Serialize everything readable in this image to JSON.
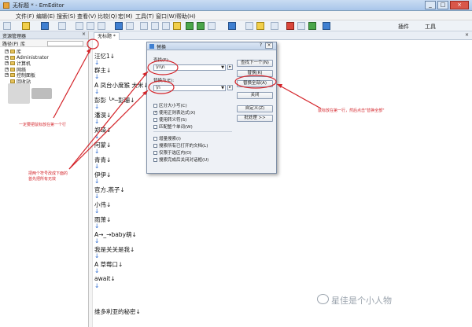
{
  "window": {
    "title": "无标题 * - EmEditor",
    "controls": [
      "_",
      "□",
      "×"
    ]
  },
  "menu": [
    "文件(F)",
    "编辑(E)",
    "搜索(S)",
    "查看(V)",
    "比较(Q)",
    "宏(M)",
    "工具(T)",
    "窗口(W)",
    "帮助(H)"
  ],
  "toolbar_right": [
    "插件",
    "工具"
  ],
  "sidebar": {
    "header": "资源管理器",
    "close": "×",
    "path_label": "路径(P)",
    "library": "库",
    "tree": [
      "库",
      "Administrator",
      "计算机",
      "网络",
      "控制面板",
      "回收站"
    ]
  },
  "tab": {
    "label": "无标题 *",
    "close": "×"
  },
  "editor_lines": [
    "汪忆1↓",
    "↓",
    "群主↓",
    "↓",
    "A  凤台小度猴  大米↓",
    "↓",
    "彭彭 ╰*─彭珊↓",
    "↓",
    "潘淏↓",
    "↓",
    "郑琦↓",
    "↓",
    "阿蒙↓",
    "↓",
    "青青↓",
    "↓",
    "伊伊↓",
    "↓",
    "官方.燕子↓",
    "↓",
    "小伟↓",
    "↓",
    "雨萧↓",
    "↓",
    "A→_→baby萌↓",
    "↓",
    "我是关关是我↓",
    "↓",
    "A  草莓口↓",
    "↓",
    "await↓",
    "↓",
    "维多利亚的秘密↓"
  ],
  "dialog": {
    "title": "替换",
    "help": "?",
    "close": "×",
    "find_label": "查找(F):",
    "find_value": "\\n\\n",
    "replace_label": "替换为(E):",
    "replace_value": "\\n",
    "buttons": [
      "查找下一个(N)",
      "替换(R)",
      "替换全部(A)",
      "关闭",
      "自定义(Z)",
      "批处理 >>"
    ],
    "checkboxes": [
      {
        "label": "区分大小写(C)",
        "checked": false
      },
      {
        "label": "使用正则表达式(X)",
        "checked": true
      },
      {
        "label": "使用转义符(S)",
        "checked": false
      },
      {
        "label": "匹配整个单词(W)",
        "checked": false
      },
      {
        "label": "增量搜索(I)",
        "checked": false
      },
      {
        "label": "搜索所有已打开的文档(L)",
        "checked": false
      },
      {
        "label": "仅限于选区内(O)",
        "checked": false
      },
      {
        "label": "搜索完成后关闭对话框(U)",
        "checked": false
      }
    ]
  },
  "annotations": {
    "left": "一定要把鼠标放在第一个行",
    "middle": "把两个符号改成下面的\n首先把所有无效",
    "right": "鼠标放在第一行，然后点击\"替换全部\""
  },
  "watermark": "星佳是个小人物",
  "colors": {
    "annotation": "#d4242a",
    "accent": "#3f7fd1"
  }
}
